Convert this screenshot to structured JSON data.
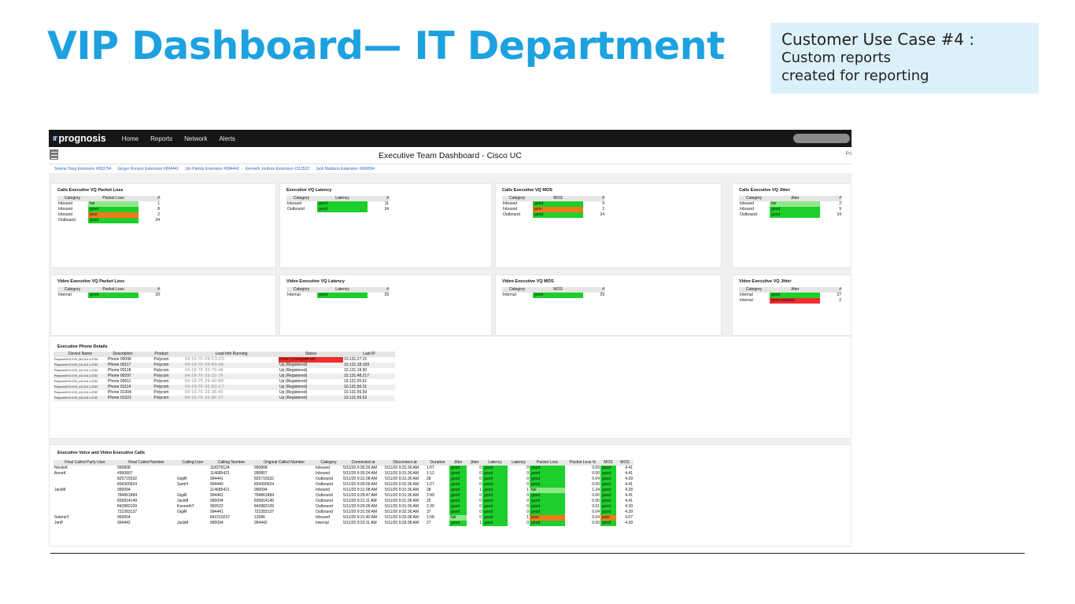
{
  "slide": {
    "title": "VIP Dashboard— IT Department",
    "use_case_line1": "Customer Use Case #4 :",
    "use_case_line2": "Custom reports",
    "use_case_line3": "created for reporting"
  },
  "colors": {
    "title": "#1da1e0",
    "good": "#1dcf2a",
    "fair": "#8ee88a",
    "poor": "#f07a1a",
    "bad": "#f22e2e",
    "navbar": "#161616"
  },
  "app": {
    "logo_mark": "ır",
    "logo_icon": "ir-logo-icon",
    "logo_text": "prognosis",
    "nav": [
      "Home",
      "Reports",
      "Network",
      "Alerts"
    ],
    "dashboard_title": "Executive Team Dashboard - Cisco UC",
    "print_link": "Pri",
    "extensions": [
      "Selena Yong Extension #993754",
      "Ginger Ronson Extension #994441",
      "Jim Patrick Extension #994442",
      "Kenneth Jonfson Extension #113522",
      "Jack Madison Extension #990094"
    ]
  },
  "panels": [
    {
      "title": "Calls Executive VQ Packet Loss",
      "metric": "Packet Loss",
      "rows": [
        [
          "Inbound",
          "fair",
          "1"
        ],
        [
          "Inbound",
          "good",
          "8"
        ],
        [
          "Inbound",
          "poor",
          "2"
        ],
        [
          "Outbound",
          "good",
          "24"
        ]
      ]
    },
    {
      "title": "Executive VQ Latency",
      "metric": "Latency",
      "rows": [
        [
          "Inbound",
          "good",
          "11"
        ],
        [
          "Outbound",
          "good",
          "24"
        ]
      ]
    },
    {
      "title": "Calls Executive VQ MOS",
      "metric": "MOS",
      "rows": [
        [
          "Inbound",
          "good",
          "9"
        ],
        [
          "Inbound",
          "poor",
          "2"
        ],
        [
          "Outbound",
          "good",
          "24"
        ]
      ]
    },
    {
      "title": "Calls Executive VQ Jitter",
      "metric": "Jitter",
      "rows": [
        [
          "Inbound",
          "fair",
          "2"
        ],
        [
          "Inbound",
          "good",
          "9"
        ],
        [
          "Outbound",
          "good",
          "24"
        ]
      ]
    },
    {
      "title": "Video Executive VQ Packet Loss",
      "metric": "Packet Loss",
      "rows": [
        [
          "Internal",
          "good",
          "29"
        ]
      ]
    },
    {
      "title": "Video Executive VQ Latency",
      "metric": "Latency",
      "rows": [
        [
          "Internal",
          "good",
          "29"
        ]
      ]
    },
    {
      "title": "Video Executive VQ MOS",
      "metric": "MOS",
      "rows": [
        [
          "Internal",
          "good",
          "29"
        ]
      ]
    },
    {
      "title": "Video Executive VQ Jitter",
      "metric": "Jitter",
      "rows": [
        [
          "Internal",
          "good",
          "27"
        ],
        [
          "Internal",
          "unacceptable",
          "2"
        ]
      ]
    }
  ],
  "panel_labels": {
    "category": "Category",
    "count": "#"
  },
  "phones": {
    "title": "Executive Phone Details",
    "headers": [
      "Device Name",
      "Description",
      "Product",
      "Load Info Running",
      "Status",
      "Last IP"
    ],
    "rows": [
      [
        "PolycomVVX-VVX_501.5.6.1.4732",
        "Phone 00096",
        "Polycom",
        "64-16-7F-09-C3-C5",
        "Down (Unregistered)",
        "10.131.27.21"
      ],
      [
        "PolycomVVX-VVX_411.5.6.1.4732",
        "Phone 00117",
        "Polycom",
        "64-16-7F-09-B9-68",
        "Up (Registered)",
        "10.131.18.109"
      ],
      [
        "PolycomVVX-VVX_411.5.6.1.4732",
        "Phone 00118",
        "Polycom",
        "64-16-7F-32-79-48",
        "Up (Registered)",
        "10.131.18.90"
      ],
      [
        "PolycomVVX-VVX_411.5.6.1.4732",
        "Phone 00297",
        "Polycom",
        "64-16-7F-26-32-7F",
        "Up (Registered)",
        "10.131.48.217"
      ],
      [
        "PolycomVVX-VVX_411.5.6.1.4732",
        "Phone 00611",
        "Polycom",
        "64-16-7F-26-40-8D",
        "Up (Registered)",
        "10.131.55.61"
      ],
      [
        "PolycomVVX-VVX_411.5.6.1.4732",
        "Phone 01114",
        "Polycom",
        "64-16-7F-32-B2-C7",
        "Up (Registered)",
        "10.131.56.31"
      ],
      [
        "PolycomVVX-VVX_411.5.6.1.4732",
        "Phone 01304",
        "Polycom",
        "64-16-7F-26-38-43",
        "Up (Registered)",
        "10.131.56.59"
      ],
      [
        "PolycomVVX-VVX_411.5.6.1.4732",
        "Phone 01321",
        "Polycom",
        "64-16-7F-32-9F-37",
        "Up (Registered)",
        "10.131.56.63"
      ]
    ]
  },
  "calls": {
    "title": "Executive Voice and Video Executive Calls",
    "headers": [
      "Final Called Party User",
      "Final Called Number",
      "Calling User",
      "Calling Number",
      "Original Called Number",
      "Category",
      "Connected at",
      "Disconnect at",
      "Duration",
      "Jitter",
      "Jitter",
      "Latency",
      "Latency",
      "Packet Loss",
      "Packet Loss %",
      "MOS",
      "MOS"
    ],
    "rows": [
      [
        "NicoleK",
        "990808",
        "",
        "118279124",
        "990808",
        "Inbound",
        "5/11/20 9:30:29 AM",
        "5/11/20 9:31:36 AM",
        "1:07",
        "good",
        "0",
        "good",
        "0",
        "good",
        "0.00",
        "good",
        "4.41"
      ],
      [
        "AnneK",
        "#990807",
        "",
        "114685421",
        "990807",
        "Inbound",
        "5/11/20 9:30:24 AM",
        "5/11/20 9:31:36 AM",
        "1:12",
        "good",
        "0",
        "good",
        "0",
        "good",
        "0.00",
        "good",
        "4.41"
      ],
      [
        "",
        "825715532",
        "GigiR",
        "994441",
        "825715532",
        "Outbound",
        "5/11/20 9:31:08 AM",
        "5/11/20 9:31:36 AM",
        "28",
        "good",
        "0",
        "good",
        "0",
        "good",
        "0.04",
        "good",
        "4.39"
      ],
      [
        "",
        "834300924",
        "SamH",
        "994440",
        "834300924",
        "Outbound",
        "5/11/20 9:30:09 AM",
        "5/11/20 9:31:36 AM",
        "1:27",
        "good",
        "0",
        "good",
        "0",
        "good",
        "0.00",
        "good",
        "4.41"
      ],
      [
        "JackM",
        "990094",
        "",
        "114685421",
        "990094",
        "Inbound",
        "5/11/20 9:31:08 AM",
        "5/11/20 9:31:36 AM",
        "28",
        "good",
        "1",
        "good",
        "1",
        "fair",
        "1.34",
        "good",
        "4.28"
      ],
      [
        "",
        "784861884",
        "GigiR",
        "994441",
        "784861884",
        "Outbound",
        "5/11/20 9:28:47 AM",
        "5/11/20 9:31:36 AM",
        "2:49",
        "good",
        "0",
        "good",
        "0",
        "good",
        "0.00",
        "good",
        "4.41"
      ],
      [
        "",
        "835814149",
        "JackM",
        "990094",
        "835814149",
        "Outbound",
        "5/11/20 9:31:11 AM",
        "5/11/20 9:31:36 AM",
        "25",
        "good",
        "0",
        "good",
        "0",
        "good",
        "0.00",
        "good",
        "4.41"
      ],
      [
        "",
        "842882109",
        "KennethT",
        "993522",
        "842882109",
        "Outbound",
        "5/11/20 9:29:06 AM",
        "5/11/20 9:31:36 AM",
        "2:30",
        "good",
        "0",
        "good",
        "0",
        "good",
        "0.01",
        "good",
        "4.39"
      ],
      [
        "",
        "722283137",
        "GigiR",
        "994441",
        "722283137",
        "Outbound",
        "5/11/20 9:31:59 AM",
        "5/11/20 9:32:36 AM",
        "37",
        "good",
        "0",
        "good",
        "0",
        "good",
        "0.04",
        "good",
        "4.39"
      ],
      [
        "SeleneY",
        "993654",
        "",
        "842219237",
        "12086",
        "Inbound",
        "5/11/20 9:31:40 AM",
        "5/11/20 9:33:38 AM",
        "1:58",
        "fair",
        "0",
        "good",
        "1",
        "poor",
        "5.04",
        "poor",
        "3.07"
      ],
      [
        "JimP",
        "994442",
        "JackM",
        "990094",
        "994442",
        "Internal",
        "5/11/20 9:33:11 AM",
        "5/11/20 9:33:38 AM",
        "27",
        "good",
        "1",
        "good",
        "0",
        "good",
        "0.00",
        "good",
        "4.39"
      ]
    ]
  }
}
